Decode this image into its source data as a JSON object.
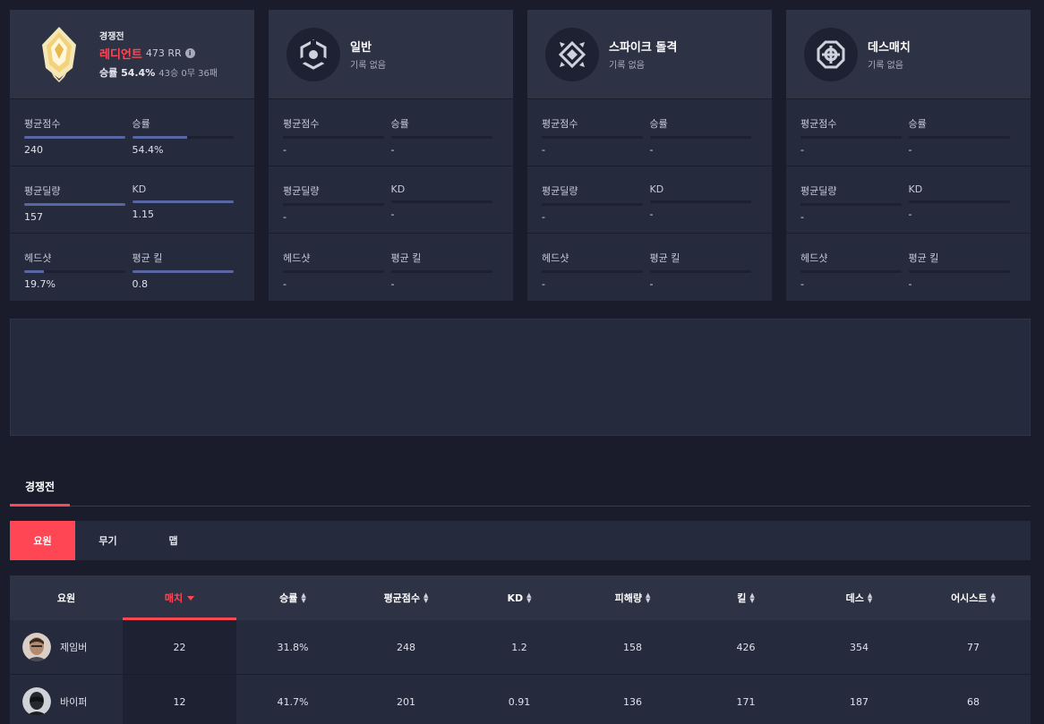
{
  "competitive_card": {
    "mode": "경쟁전",
    "rank_name": "레디언트",
    "rr": "473 RR",
    "win_rate_label": "승률 54.4%",
    "record": "43승 0무 36패",
    "stats": [
      {
        "label": "평균점수",
        "value": "240",
        "bar": 1.0
      },
      {
        "label": "승률",
        "value": "54.4%",
        "bar": 0.544
      },
      {
        "label": "평균딜량",
        "value": "157",
        "bar": 1.0
      },
      {
        "label": "KD",
        "value": "1.15",
        "bar": 1.0
      },
      {
        "label": "헤드샷",
        "value": "19.7%",
        "bar": 0.197
      },
      {
        "label": "평균 킬",
        "value": "0.8",
        "bar": 1.0
      }
    ]
  },
  "mode_cards": [
    {
      "name": "일반",
      "sub": "기록 없음",
      "icon": "unrated-icon",
      "stats": [
        {
          "label": "평균점수",
          "value": "-"
        },
        {
          "label": "승률",
          "value": "-"
        },
        {
          "label": "평균딜량",
          "value": "-"
        },
        {
          "label": "KD",
          "value": "-"
        },
        {
          "label": "헤드샷",
          "value": "-"
        },
        {
          "label": "평균 킬",
          "value": "-"
        }
      ]
    },
    {
      "name": "스파이크 돌격",
      "sub": "기록 없음",
      "icon": "spike-rush-icon",
      "stats": [
        {
          "label": "평균점수",
          "value": "-"
        },
        {
          "label": "승률",
          "value": "-"
        },
        {
          "label": "평균딜량",
          "value": "-"
        },
        {
          "label": "KD",
          "value": "-"
        },
        {
          "label": "헤드샷",
          "value": "-"
        },
        {
          "label": "평균 킬",
          "value": "-"
        }
      ]
    },
    {
      "name": "데스매치",
      "sub": "기록 없음",
      "icon": "deathmatch-icon",
      "stats": [
        {
          "label": "평균점수",
          "value": "-"
        },
        {
          "label": "승률",
          "value": "-"
        },
        {
          "label": "평균딜량",
          "value": "-"
        },
        {
          "label": "KD",
          "value": "-"
        },
        {
          "label": "헤드샷",
          "value": "-"
        },
        {
          "label": "평균 킬",
          "value": "-"
        }
      ]
    }
  ],
  "section_tab": "경쟁전",
  "subtabs": [
    "요원",
    "무기",
    "맵"
  ],
  "table": {
    "headers": [
      "요원",
      "매치",
      "승률",
      "평균점수",
      "KD",
      "피해량",
      "킬",
      "데스",
      "어시스트"
    ],
    "rows": [
      [
        "제임버",
        "22",
        "31.8%",
        "248",
        "1.2",
        "158",
        "426",
        "354",
        "77"
      ],
      [
        "바이퍼",
        "12",
        "41.7%",
        "201",
        "0.91",
        "136",
        "171",
        "187",
        "68"
      ]
    ]
  },
  "colors": {
    "accent": "#ff4655",
    "bar": "#5867a3",
    "card": "#262a3d",
    "background": "#1a1c2b"
  }
}
